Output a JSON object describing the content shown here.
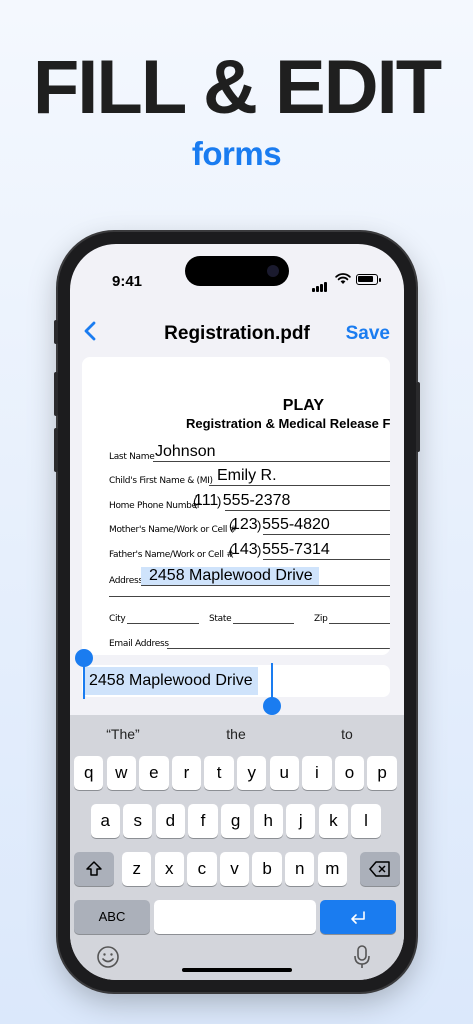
{
  "promo": {
    "headline": "FILL & EDIT",
    "subhead": "forms"
  },
  "status_bar": {
    "time": "9:41"
  },
  "nav": {
    "back_icon": "chevron-left-icon",
    "title": "Registration.pdf",
    "save_label": "Save"
  },
  "document": {
    "title": "PLAY",
    "subtitle": "Registration & Medical Release F",
    "fields": [
      {
        "label": "Last Name",
        "value": "Johnson"
      },
      {
        "label": "Child's First Name & (MI)",
        "value": "Emily R."
      },
      {
        "label": "Home Phone Number",
        "value": "111   555-2378"
      },
      {
        "label": "Mother's Name/Work or Cell #",
        "value": "123   555-4820"
      },
      {
        "label": "Father's Name/Work or Cell #",
        "value": "143   555-7314"
      },
      {
        "label": "Address",
        "value": "2458 Maplewood Drive"
      },
      {
        "city_label": "City",
        "state_label": "State",
        "zip_label": "Zip"
      },
      {
        "label": "Email Address",
        "value": ""
      }
    ],
    "paren_open": "(",
    "paren_close": ")"
  },
  "edit_field": {
    "value": "2458 Maplewood Drive"
  },
  "keyboard": {
    "suggestions": [
      "“The”",
      "the",
      "to"
    ],
    "row1": [
      "q",
      "w",
      "e",
      "r",
      "t",
      "y",
      "u",
      "i",
      "o",
      "p"
    ],
    "row2": [
      "a",
      "s",
      "d",
      "f",
      "g",
      "h",
      "j",
      "k",
      "l"
    ],
    "row3": [
      "z",
      "x",
      "c",
      "v",
      "b",
      "n",
      "m"
    ],
    "abc_label": "ABC",
    "shift_icon": "shift-icon",
    "backspace_icon": "backspace-icon",
    "return_icon": "return-icon",
    "emoji_icon": "emoji-icon",
    "mic_icon": "microphone-icon"
  },
  "colors": {
    "accent": "#1a7cf0",
    "headline": "#1f1f1f",
    "highlight": "#cfe3fb"
  }
}
